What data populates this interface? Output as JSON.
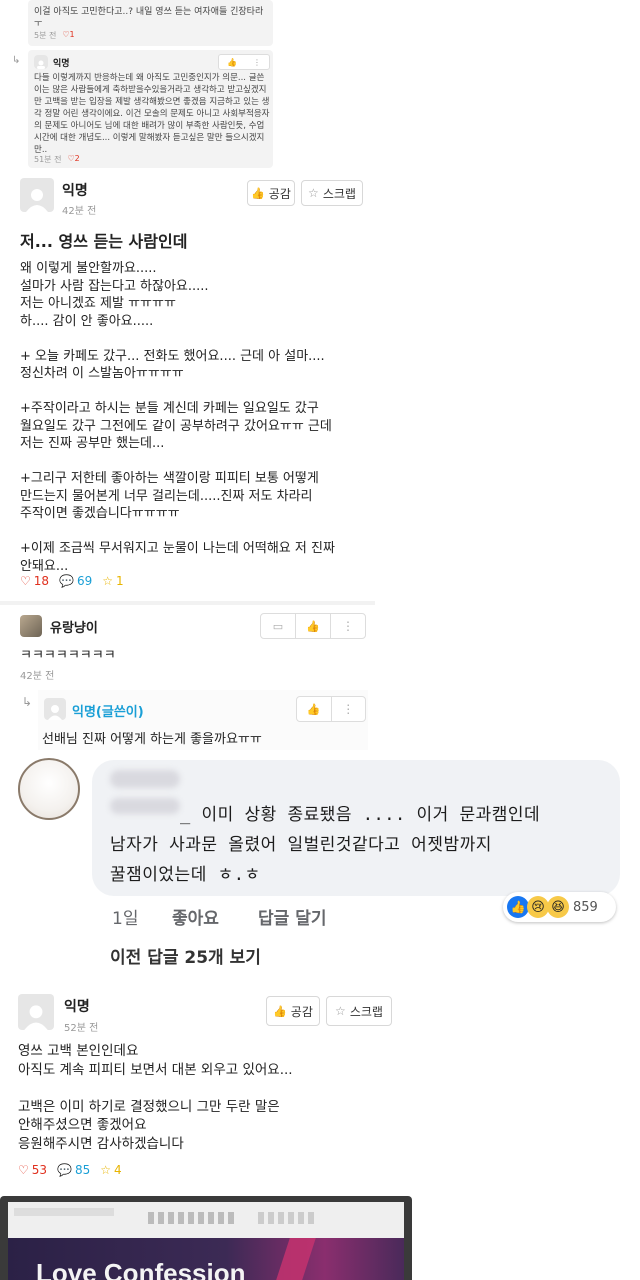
{
  "top_thread": {
    "reply1_text": "이걸 아직도 고민한다고..? 내일 영쓰 듣는 여자애들 긴장타라 ㅜ",
    "reply1_time": "5분 전",
    "reply1_likes": "1",
    "reply2_author": "익명",
    "reply2_text": "다들 이렇게까지 반응하는데 왜 아직도 고민중인지가 의문... 글쓴이는 많은 사람들에게 축하받을수있을거라고 생각하고 받고싶겠지만 고백을 받는 입장을 제발 생각해봤으면 좋겠음 지금하고 있는 생각 정말 어린 생각이에요. 이건 모솔의 문제도 아니고 사회부적응자의 문제도 아니어도 님에 대한 배려가 많이 부족한 사람인듯, 수업시간에 대한 개념도... 이렇게 말해봤자 듣고싶은 말만 들으시겠지만..",
    "reply2_time": "51분 전",
    "reply2_likes": "2"
  },
  "post1": {
    "author": "익명",
    "time": "42분 전",
    "btn_empathy": "공감",
    "btn_scrap": "스크랩",
    "title": "저... 영쓰 듣는 사람인데",
    "body": "왜 이렇게 불안할까요.....\n설마가 사람 잡는다고 하잖아요.....\n저는 아니겠죠 제발 ㅠㅠㅠㅠ\n하.... 감이 안 좋아요.....\n\n+ 오늘 카페도 갔구... 전화도 했어요.... 근데 아 설마....\n정신차려 이 스발놈아ㅠㅠㅠㅠ\n\n+주작이라고 하시는 분들 계신데 카페는 일요일도 갔구\n월요일도 갔구 그전에도 같이 공부하려구 갔어요ㅠㅠ 근데\n저는 진짜 공부만 했는데...\n\n+그리구 저한테 좋아하는 색깔이랑 피피티 보통 어떻게\n만드는지 물어본게 너무 걸리는데.....진짜 저도 차라리\n주작이면 좋겠습니다ㅠㅠㅠㅠ\n\n+이제 조금씩 무서워지고 눈물이 나는데 어떡해요 저 진짜\n안돼요...",
    "likes": "18",
    "comments": "69",
    "scraps": "1"
  },
  "comment1": {
    "author": "유랑냥이",
    "text": "ㅋㅋㅋㅋㅋㅋㅋㅋ",
    "time": "42분 전"
  },
  "reply_op": {
    "author": "익명(글쓴이)",
    "text": "선배님 진짜 어떻게 하는게 좋을까요ㅠㅠ"
  },
  "fb_comment": {
    "text_line1": "_ 이미 상황 종료됐음 .... 이거 문과캠인데",
    "text_line2": "남자가 사과문 올렸어 일벌린것같다고 어젯밤까지",
    "text_line3": "꿀잼이었는데 ㅎ.ㅎ",
    "time": "1일",
    "like_action": "좋아요",
    "reply_action": "답글 달기",
    "reaction_count": "859",
    "view_more": "이전 답글 25개 보기"
  },
  "post2": {
    "author": "익명",
    "time": "52분 전",
    "btn_empathy": "공감",
    "btn_scrap": "스크랩",
    "body": "영쓰 고백 본인인데요\n아직도 계속 피피티 보면서 대본 외우고 있어요...\n\n고백은 이미 하기로 결정했으니 그만 두란 말은\n안해주셨으면 좋겠어요\n응원해주시면 감사하겠습니다",
    "likes": "53",
    "comments": "85",
    "scraps": "4"
  },
  "ppt_preview": {
    "title": "Love Confession"
  },
  "colors": {
    "like_red": "#e0301e",
    "comment_blue": "#1a9fd6",
    "scrap_yellow": "#e8b400",
    "fb_bubble": "#f0f2f5",
    "fb_like_blue": "#1877f2"
  }
}
